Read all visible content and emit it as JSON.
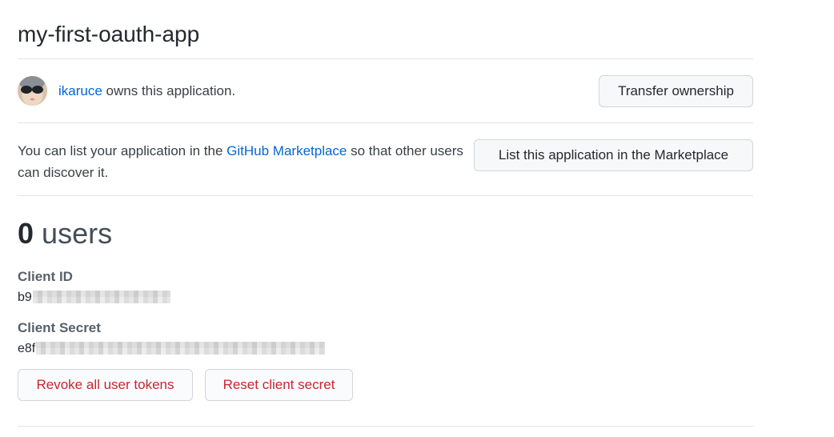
{
  "app": {
    "title": "my-first-oauth-app"
  },
  "owner": {
    "username": "ikaruce",
    "owns_text": " owns this application.",
    "transfer_button": "Transfer ownership"
  },
  "marketplace": {
    "text_before": "You can list your application in the ",
    "link_text": "GitHub Marketplace",
    "text_after": " so that other users can discover it.",
    "list_button": "List this application in the Marketplace"
  },
  "stats": {
    "users_count": "0",
    "users_label": "users"
  },
  "credentials": {
    "client_id_label": "Client ID",
    "client_id_visible": "b9",
    "client_secret_label": "Client Secret",
    "client_secret_visible": "e8f"
  },
  "actions": {
    "revoke_tokens": "Revoke all user tokens",
    "reset_secret": "Reset client secret"
  },
  "colors": {
    "link": "#0366d6",
    "danger": "#cb2431",
    "border": "#e1e4e8"
  }
}
